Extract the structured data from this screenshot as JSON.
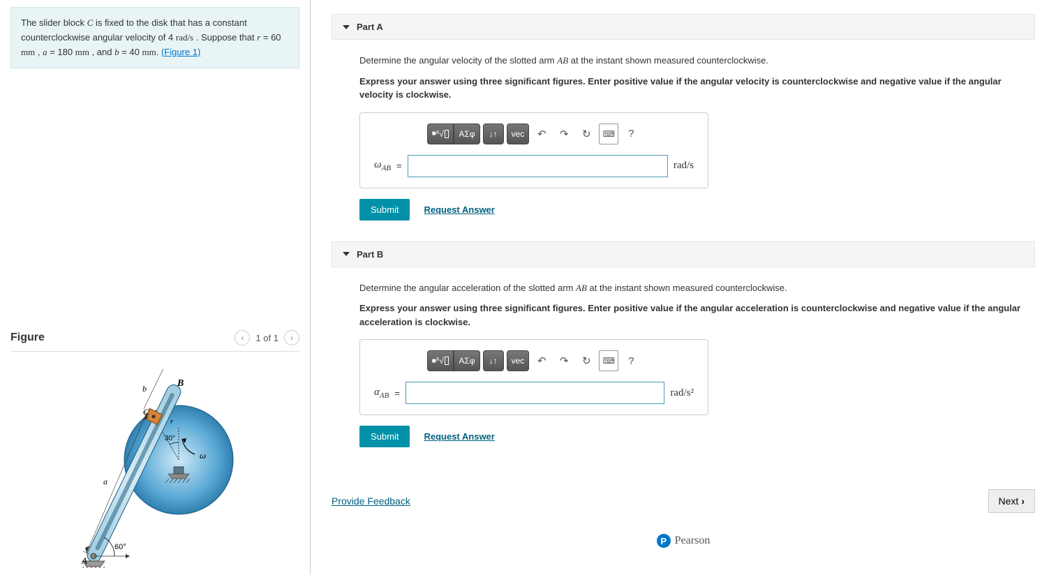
{
  "problem": {
    "text_parts": {
      "p1": "The slider block ",
      "var_c": "C",
      "p2": " is fixed to the disk that has a constant counterclockwise angular velocity of 4 ",
      "unit_rads": "rad/s",
      "p3": " . Suppose that ",
      "var_r": "r",
      "p4": " = 60 ",
      "unit_mm1": "mm",
      "p5": " , ",
      "var_a": "a",
      "p6": " = 180 ",
      "unit_mm2": "mm",
      "p7": " , and ",
      "var_b": "b",
      "p8": " = 40 ",
      "unit_mm3": "mm",
      "p9": ". ",
      "figure_link": "(Figure 1)"
    }
  },
  "figure": {
    "title": "Figure",
    "counter": "1 of 1",
    "labels": {
      "A": "A",
      "B": "B",
      "C": "C",
      "a": "a",
      "b": "b",
      "r": "r",
      "omega": "ω",
      "angle30": "30°",
      "angle60": "60°"
    }
  },
  "partA": {
    "title": "Part A",
    "prompt_pre": "Determine the angular velocity of the slotted arm ",
    "prompt_var": "AB",
    "prompt_post": " at the instant shown measured counterclockwise.",
    "instruction": "Express your answer using three significant figures. Enter positive value if the angular velocity is counterclockwise and negative value if the angular velocity is clockwise.",
    "variable": "ω",
    "variable_sub": "AB",
    "equals": " = ",
    "unit": "rad/s",
    "submit": "Submit",
    "request": "Request Answer"
  },
  "partB": {
    "title": "Part B",
    "prompt_pre": "Determine the angular acceleration of the slotted arm ",
    "prompt_var": "AB",
    "prompt_post": " at the instant shown measured counterclockwise.",
    "instruction": "Express your answer using three significant figures. Enter positive value if the angular acceleration is counterclockwise and negative value if the angular acceleration is clockwise.",
    "variable": "α",
    "variable_sub": "AB",
    "equals": " = ",
    "unit": "rad/s²",
    "submit": "Submit",
    "request": "Request Answer"
  },
  "toolbar": {
    "templates": "■√☐",
    "greek": "ΑΣφ",
    "scripts": "↓↑",
    "vec": "vec",
    "undo": "↶",
    "redo": "↷",
    "reset": "↻",
    "keyboard": "⌨",
    "help": "?"
  },
  "footer": {
    "feedback": "Provide Feedback",
    "next": "Next",
    "pearson": "Pearson"
  }
}
